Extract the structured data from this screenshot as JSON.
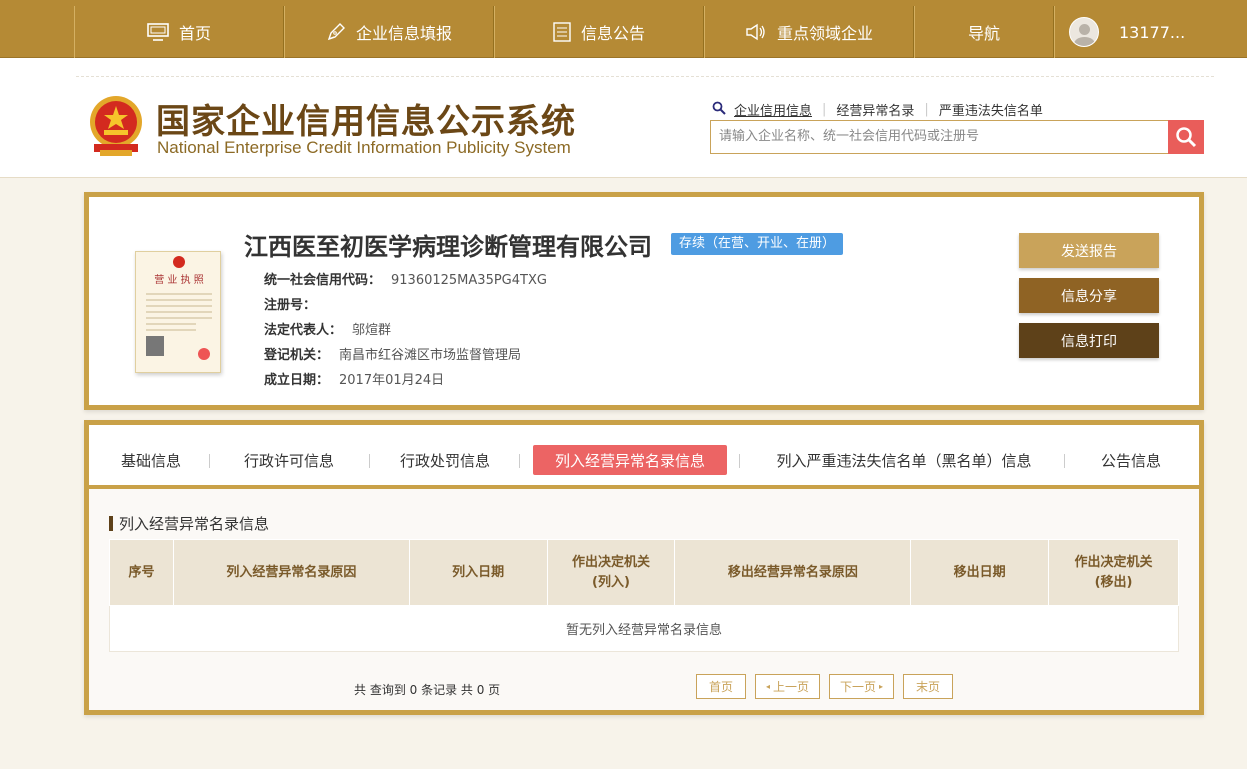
{
  "topnav": {
    "items": [
      {
        "label": "首页",
        "icon": "monitor-icon"
      },
      {
        "label": "企业信息填报",
        "icon": "pen-icon"
      },
      {
        "label": "信息公告",
        "icon": "document-icon"
      },
      {
        "label": "重点领域企业",
        "icon": "speaker-icon"
      },
      {
        "label": "导航"
      }
    ],
    "user": "13177..."
  },
  "header": {
    "logo_cn": "国家企业信用信息公示系统",
    "logo_en": "National Enterprise Credit Information Publicity System",
    "search_tabs": [
      "企业信用信息",
      "经营异常名录",
      "严重违法失信名单"
    ],
    "search_placeholder": "请输入企业名称、统一社会信用代码或注册号"
  },
  "company": {
    "name": "江西医至初医学病理诊断管理有限公司",
    "status": "存续（在营、开业、在册）",
    "license_title": "营 业 执 照",
    "fields": [
      {
        "key": "统一社会信用代码：",
        "value": "91360125MA35PG4TXG"
      },
      {
        "key": "注册号：",
        "value": ""
      },
      {
        "key": "法定代表人：",
        "value": "邬煊群"
      },
      {
        "key": "登记机关：",
        "value": "南昌市红谷滩区市场监督管理局"
      },
      {
        "key": "成立日期：",
        "value": "2017年01月24日"
      }
    ],
    "buttons": {
      "report": "发送报告",
      "share": "信息分享",
      "print": "信息打印"
    }
  },
  "tabs": [
    "基础信息",
    "行政许可信息",
    "行政处罚信息",
    "列入经营异常名录信息",
    "列入严重违法失信名单（黑名单）信息",
    "公告信息"
  ],
  "active_tab": 3,
  "section": {
    "title": "列入经营异常名录信息",
    "columns": [
      "序号",
      "列入经营异常名录原因",
      "列入日期",
      "作出决定机关\n(列入)",
      "移出经营异常名录原因",
      "移出日期",
      "作出决定机关\n(移出)"
    ],
    "empty_text": "暂无列入经营异常名录信息"
  },
  "pager": {
    "info": "共 查询到 0 条记录 共 0 页",
    "first": "首页",
    "prev": "上一页",
    "next": "下一页",
    "last": "末页"
  },
  "colors": {
    "nav_bg": "#b58a35",
    "gold_border": "#c9a148",
    "active_tab": "#ec6464",
    "status_badge": "#4e9ce2",
    "search_button": "#e95d5a"
  }
}
